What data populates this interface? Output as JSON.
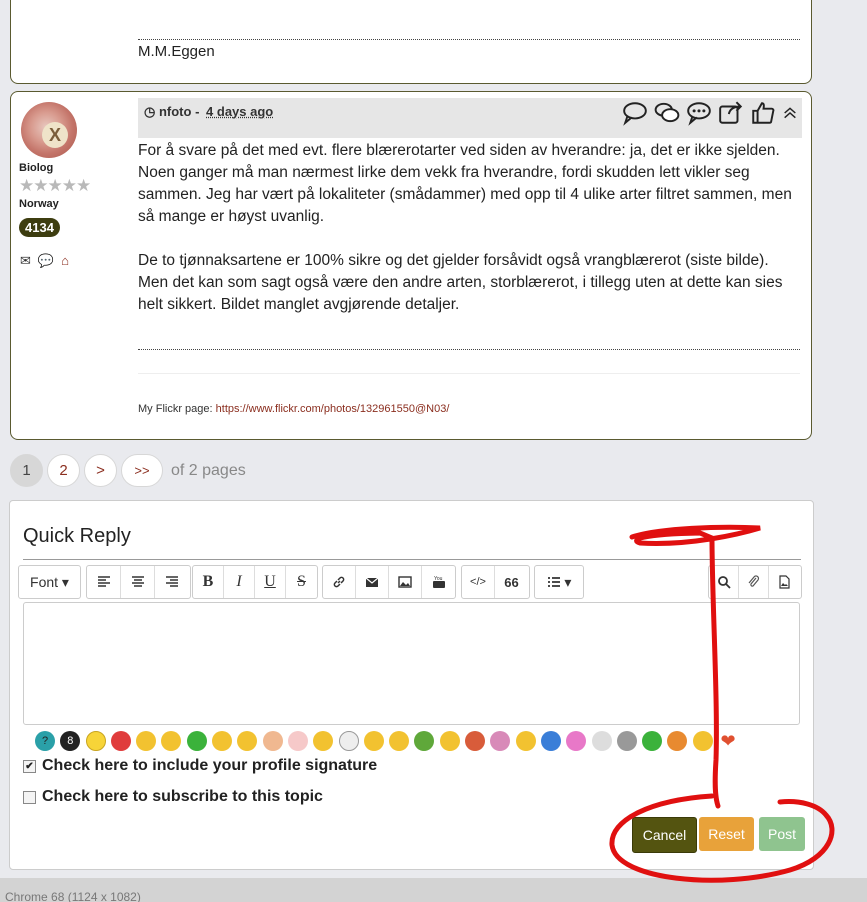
{
  "post1": {
    "signature": "M.M.Eggen"
  },
  "post2": {
    "user": {
      "rank": "Biolog",
      "country": "Norway",
      "post_count": "4134"
    },
    "author": "nfoto",
    "separator": "-",
    "date": "4 days ago",
    "paragraphs": [
      "For å svare på det med evt. flere blærerotarter ved siden av hverandre: ja, det er ikke sjelden. Noen ganger må man nærmest lirke dem vekk fra hverandre, fordi skudden lett vikler seg sammen. Jeg har vært på lokaliteter (smådammer) med opp til 4 ulike arter filtret sammen, men så mange er høyst uvanlig.",
      "De to tjønnaksartene er 100% sikre og det gjelder forsåvidt også vrangblærerot (siste bilde). Men det kan som sagt også være den andre arten, storblærerot, i tillegg uten at dette kan sies helt sikkert. Bildet manglet avgjørende detaljer."
    ],
    "flickr_label": "My Flickr page:",
    "flickr_url": "https://www.flickr.com/photos/132961550@N03/"
  },
  "pager": {
    "p1": "1",
    "p2": "2",
    "next": ">",
    "last": ">>",
    "of_text": "of 2 pages"
  },
  "quick_reply": {
    "title": "Quick Reply",
    "font_label": "Font",
    "bold": "B",
    "italic": "I",
    "underline": "U",
    "strike": "S",
    "quote": "66",
    "code": "</>",
    "checkbox_signature": "Check here to include your profile signature",
    "checkbox_subscribe": "Check here to subscribe to this topic",
    "cancel": "Cancel",
    "reset": "Reset",
    "post": "Post"
  },
  "status_bar": "Chrome 68 (1124 x 1082)",
  "colors": {
    "accent_olive": "#545410",
    "link_red": "#8b2e1f",
    "reset_orange": "#e8a23a",
    "post_green": "#8fc48f"
  }
}
